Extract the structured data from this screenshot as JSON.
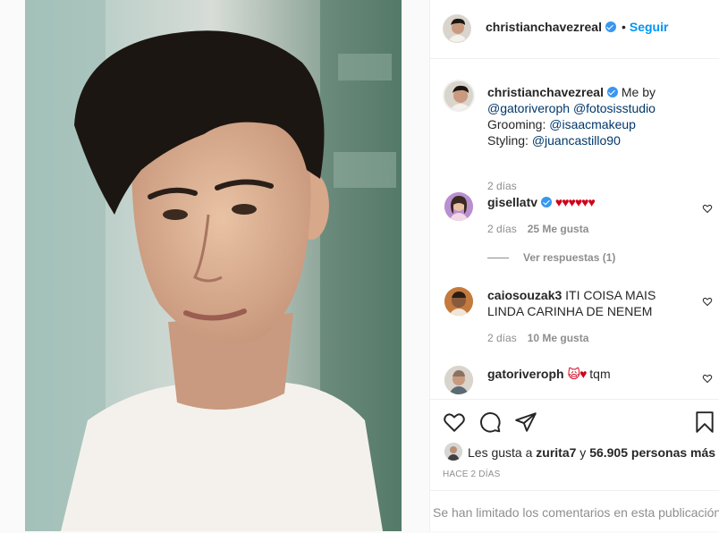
{
  "post": {
    "image_alt": "Portrait photo",
    "author": "christianchavezreal",
    "follow_label": "Seguir",
    "dot": "•"
  },
  "caption": {
    "author": "christianchavezreal",
    "text_1": "Me by",
    "mention_1": "@gatoriveroph",
    "mention_2": "@fotosisstudio",
    "grooming_label": "Grooming:",
    "mention_3": "@isaacmakeup",
    "styling_label": "Styling:",
    "mention_4": "@juancastillo90",
    "time": "2 días"
  },
  "comments": [
    {
      "author": "gisellatv",
      "text": "♥♥♥♥♥♥",
      "time": "2 días",
      "likes": "25 Me gusta",
      "replies": "Ver respuestas (1)"
    },
    {
      "author": "caiosouzak3",
      "text_line1": "ITI COISA MAIS",
      "text_line2": "LINDA CARINHA DE NENEM",
      "time": "2 días",
      "likes": "10 Me gusta"
    },
    {
      "author": "gatoriveroph",
      "emoji": "🙀♥",
      "text": "tqm"
    }
  ],
  "likes": {
    "prefix": "Les gusta a",
    "user": "zurita7",
    "connector": "y",
    "count": "56.905 personas más"
  },
  "posted_ago": "HACE 2 DÍAS",
  "comments_limited": "Se han limitado los comentarios en esta publicación",
  "colors": {
    "accent": "#0095f6",
    "verified": "#3897f0",
    "heart": "#d0021b",
    "muted": "#8e8e8e"
  },
  "icons": [
    "heart-icon",
    "comment-icon",
    "share-icon",
    "bookmark-icon",
    "verified-icon"
  ]
}
